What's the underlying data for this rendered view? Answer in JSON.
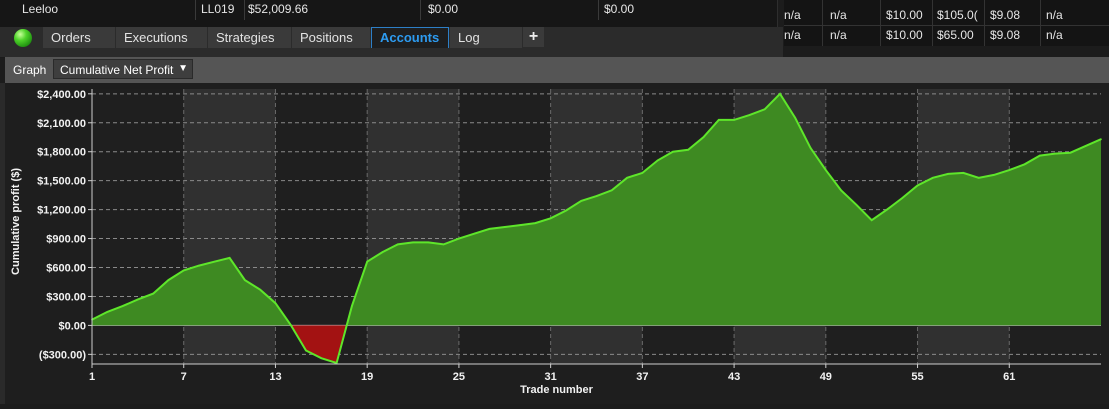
{
  "accounts_table": {
    "row": {
      "name": "Leeloo",
      "account": "LL019",
      "value1": "$52,009.66",
      "value2": "$0.00",
      "value3": "$0.00"
    }
  },
  "right_table": {
    "rows": [
      [
        "n/a",
        "n/a",
        "$10.00",
        "$105.0(",
        "$9.08",
        "n/a"
      ],
      [
        "n/a",
        "n/a",
        "$10.00",
        "$65.00",
        "$9.08",
        "n/a"
      ]
    ]
  },
  "tabs": [
    {
      "label": "Orders",
      "active": false
    },
    {
      "label": "Executions",
      "active": false
    },
    {
      "label": "Strategies",
      "active": false
    },
    {
      "label": "Positions",
      "active": false
    },
    {
      "label": "Accounts",
      "active": true
    },
    {
      "label": "Log",
      "active": false
    }
  ],
  "add_tab_label": "+",
  "status_color": "#3ccb1e",
  "graph": {
    "label": "Graph",
    "selected": "Cumulative Net Profit"
  },
  "chart_data": {
    "type": "area",
    "ylabel": "Cumulative profit ($)",
    "xlabel": "Trade number",
    "ylim": [
      -400,
      2450
    ],
    "yticks": [
      -300,
      0,
      300,
      600,
      900,
      1200,
      1500,
      1800,
      2100,
      2400
    ],
    "ytick_labels": [
      "($300.00)",
      "$0.00",
      "$300.00",
      "$600.00",
      "$900.00",
      "$1,200.00",
      "$1,500.00",
      "$1,800.00",
      "$2,100.00",
      "$2,400.00"
    ],
    "xticks": [
      1,
      7,
      13,
      19,
      25,
      31,
      37,
      43,
      49,
      55,
      61
    ],
    "x": [
      1,
      2,
      3,
      4,
      5,
      6,
      7,
      8,
      9,
      10,
      11,
      12,
      13,
      14,
      15,
      16,
      17,
      18,
      19,
      20,
      21,
      22,
      23,
      24,
      25,
      26,
      27,
      28,
      29,
      30,
      31,
      32,
      33,
      34,
      35,
      36,
      37,
      38,
      39,
      40,
      41,
      42,
      43,
      44,
      45,
      46,
      47,
      48,
      49,
      50,
      51,
      52,
      53,
      54,
      55,
      56,
      57,
      58,
      59,
      60,
      61,
      62,
      63,
      64,
      65,
      66,
      67
    ],
    "values": [
      60,
      140,
      200,
      270,
      330,
      470,
      570,
      620,
      660,
      700,
      470,
      370,
      230,
      5,
      -260,
      -340,
      -390,
      200,
      660,
      760,
      840,
      860,
      860,
      840,
      900,
      950,
      1000,
      1020,
      1040,
      1060,
      1110,
      1190,
      1290,
      1340,
      1400,
      1530,
      1580,
      1710,
      1800,
      1820,
      1950,
      2130,
      2130,
      2180,
      2240,
      2400,
      2150,
      1840,
      1610,
      1400,
      1250,
      1090,
      1200,
      1320,
      1450,
      1530,
      1570,
      1580,
      1530,
      1560,
      1610,
      1670,
      1760,
      1780,
      1790,
      1860,
      1930
    ],
    "colors": {
      "positive_fill": "#3e8a22",
      "positive_line": "#5ee62a",
      "negative_fill": "#a31212",
      "grid": "#8a8a8a",
      "band_light": "#303030",
      "band_dark": "#1f1f1f"
    }
  }
}
